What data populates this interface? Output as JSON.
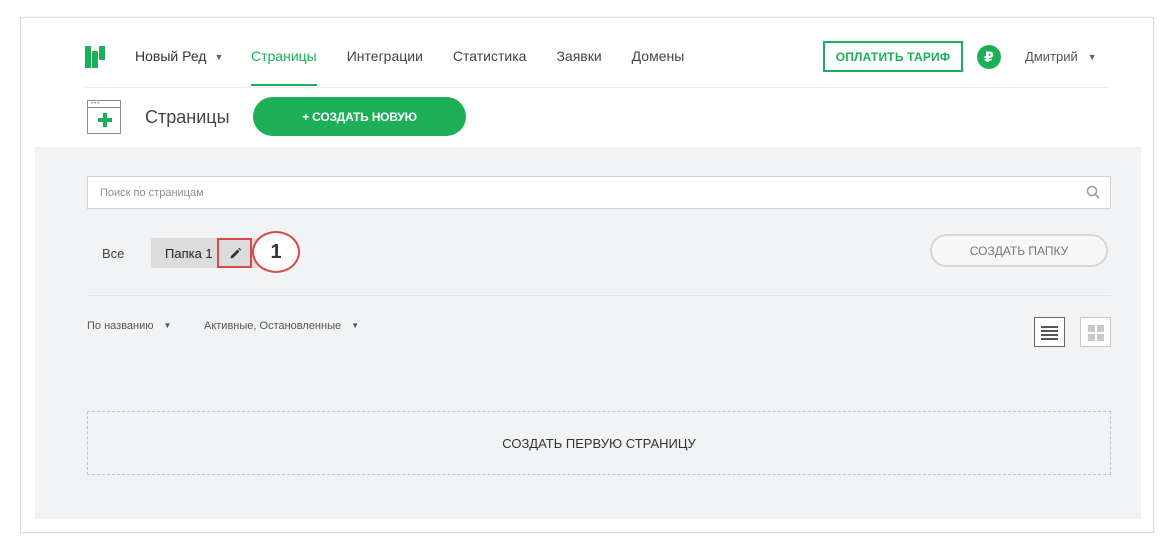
{
  "nav": {
    "project_name": "Новый Ред",
    "items": [
      {
        "label": "Страницы",
        "active": true
      },
      {
        "label": "Интеграции",
        "active": false
      },
      {
        "label": "Статистика",
        "active": false
      },
      {
        "label": "Заявки",
        "active": false
      },
      {
        "label": "Домены",
        "active": false
      }
    ],
    "pay_button": "ОПЛАТИТЬ ТАРИФ",
    "currency_symbol": "₽",
    "user_name": "Дмитрий",
    "caret": "▼"
  },
  "header": {
    "title": "Страницы",
    "create_button": "+ СОЗДАТЬ НОВУЮ"
  },
  "search": {
    "placeholder": "Поиск по страницам",
    "value": ""
  },
  "folders": {
    "all_tab": "Все",
    "active_folder": "Папка 1",
    "create_folder_button": "СОЗДАТЬ ПАПКУ"
  },
  "annotation": {
    "number": "1",
    "color": "#d84a4a"
  },
  "filters": {
    "sort": "По названию",
    "status": "Активные, Остановленные",
    "caret": "▼"
  },
  "empty_state": {
    "label": "СОЗДАТЬ ПЕРВУЮ СТРАНИЦУ"
  },
  "colors": {
    "accent": "#1bb058",
    "content_background": "#f2f3f4"
  },
  "icons": {
    "logo": "logo-icon",
    "add_page": "add-page-icon",
    "search": "search-icon",
    "edit": "pencil-icon",
    "list_view": "list-view-icon",
    "grid_view": "grid-view-icon"
  }
}
